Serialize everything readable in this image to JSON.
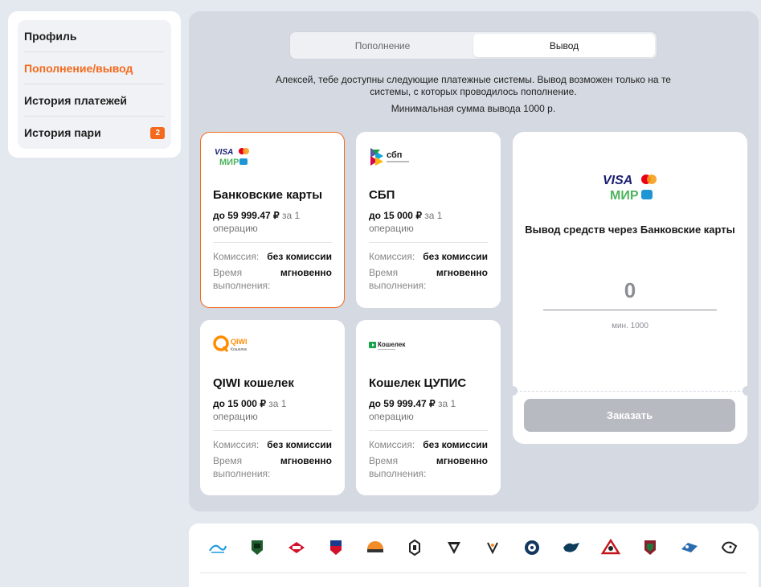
{
  "sidebar": {
    "items": [
      {
        "label": "Профиль"
      },
      {
        "label": "Пополнение/вывод"
      },
      {
        "label": "История платежей"
      },
      {
        "label": "История пари",
        "badge": "2"
      }
    ],
    "active_index": 1
  },
  "tabs": [
    {
      "label": "Пополнение"
    },
    {
      "label": "Вывод"
    }
  ],
  "info": {
    "line1": "Алексей, тебе доступны следующие платежные системы. Вывод возможен только на те системы, с которых проводилось пополнение.",
    "line2": "Минимальная сумма вывода 1000 р."
  },
  "methods": [
    {
      "name": "Банковские карты",
      "limit_amount": "до 59 999.47 ₽",
      "limit_rest": " за 1 операцию",
      "commission_label": "Комиссия:",
      "commission_value": "без комиссии",
      "time_label": "Время выполнения:",
      "time_value": "мгновенно",
      "logo": "visa-mir-icon"
    },
    {
      "name": "СБП",
      "limit_amount": "до 15 000 ₽",
      "limit_rest": " за 1 операцию",
      "commission_label": "Комиссия:",
      "commission_value": "без комиссии",
      "time_label": "Время выполнения:",
      "time_value": "мгновенно",
      "logo": "sbp-icon"
    },
    {
      "name": "QIWI кошелек",
      "limit_amount": "до 15 000 ₽",
      "limit_rest": " за 1 операцию",
      "commission_label": "Комиссия:",
      "commission_value": "без комиссии",
      "time_label": "Время выполнения:",
      "time_value": "мгновенно",
      "logo": "qiwi-icon"
    },
    {
      "name": "Кошелек ЦУПИС",
      "limit_amount": "до 59 999.47 ₽",
      "limit_rest": " за 1 операцию",
      "commission_label": "Комиссия:",
      "commission_value": "без комиссии",
      "time_label": "Время выполнения:",
      "time_value": "мгновенно",
      "logo": "cupis-icon"
    }
  ],
  "logo_text": {
    "visa": "VISA",
    "mir": "МИР",
    "sbp": "сбп",
    "qiwi": "QIWI",
    "qiwi_sub": "Кошелек",
    "cupis": "Кошелек"
  },
  "withdraw": {
    "title": "Вывод средств через Банковские карты",
    "amount": "0",
    "min_label": "мин. 1000",
    "button": "Заказать"
  },
  "clubs": [
    "zenit-icon",
    "krasnodar-icon",
    "spartak-icon",
    "cska-icon",
    "baltika-icon",
    "akron-icon",
    "torpedo-icon",
    "fakel-icon",
    "dynamo-icon",
    "sochi-icon",
    "avangard-icon",
    "rubin-icon",
    "khimki-icon",
    "lion-icon"
  ],
  "colors": {
    "accent": "#f36a1d",
    "panel": "#d4d9e2",
    "button_disabled": "#b7bac0"
  }
}
